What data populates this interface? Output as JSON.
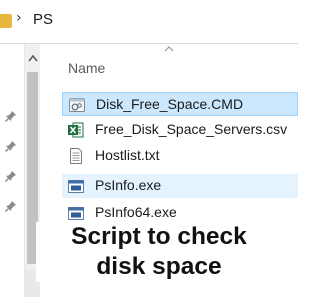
{
  "address": {
    "path": "PS",
    "folder_icon": "folder-icon",
    "separator_icon": "chevron-right-icon"
  },
  "list": {
    "column_header": "Name",
    "files": [
      {
        "name": "Disk_Free_Space.CMD",
        "icon": "cmd-script-icon",
        "state": "selected"
      },
      {
        "name": "Free_Disk_Space_Servers.csv",
        "icon": "excel-csv-icon",
        "state": "normal"
      },
      {
        "name": "Hostlist.txt",
        "icon": "text-file-icon",
        "state": "normal"
      },
      {
        "name": "PsInfo.exe",
        "icon": "exe-app-icon",
        "state": "hover"
      },
      {
        "name": "PsInfo64.exe",
        "icon": "exe-app-icon",
        "state": "normal"
      }
    ]
  },
  "overlay": {
    "line1": "Script to check",
    "line2": "disk space"
  },
  "colors": {
    "selection_bg": "#cce8ff",
    "selection_border": "#99d1ff",
    "hover_bg": "#e5f3ff",
    "folder": "#e8b83e",
    "excel_green": "#1d6f42"
  }
}
